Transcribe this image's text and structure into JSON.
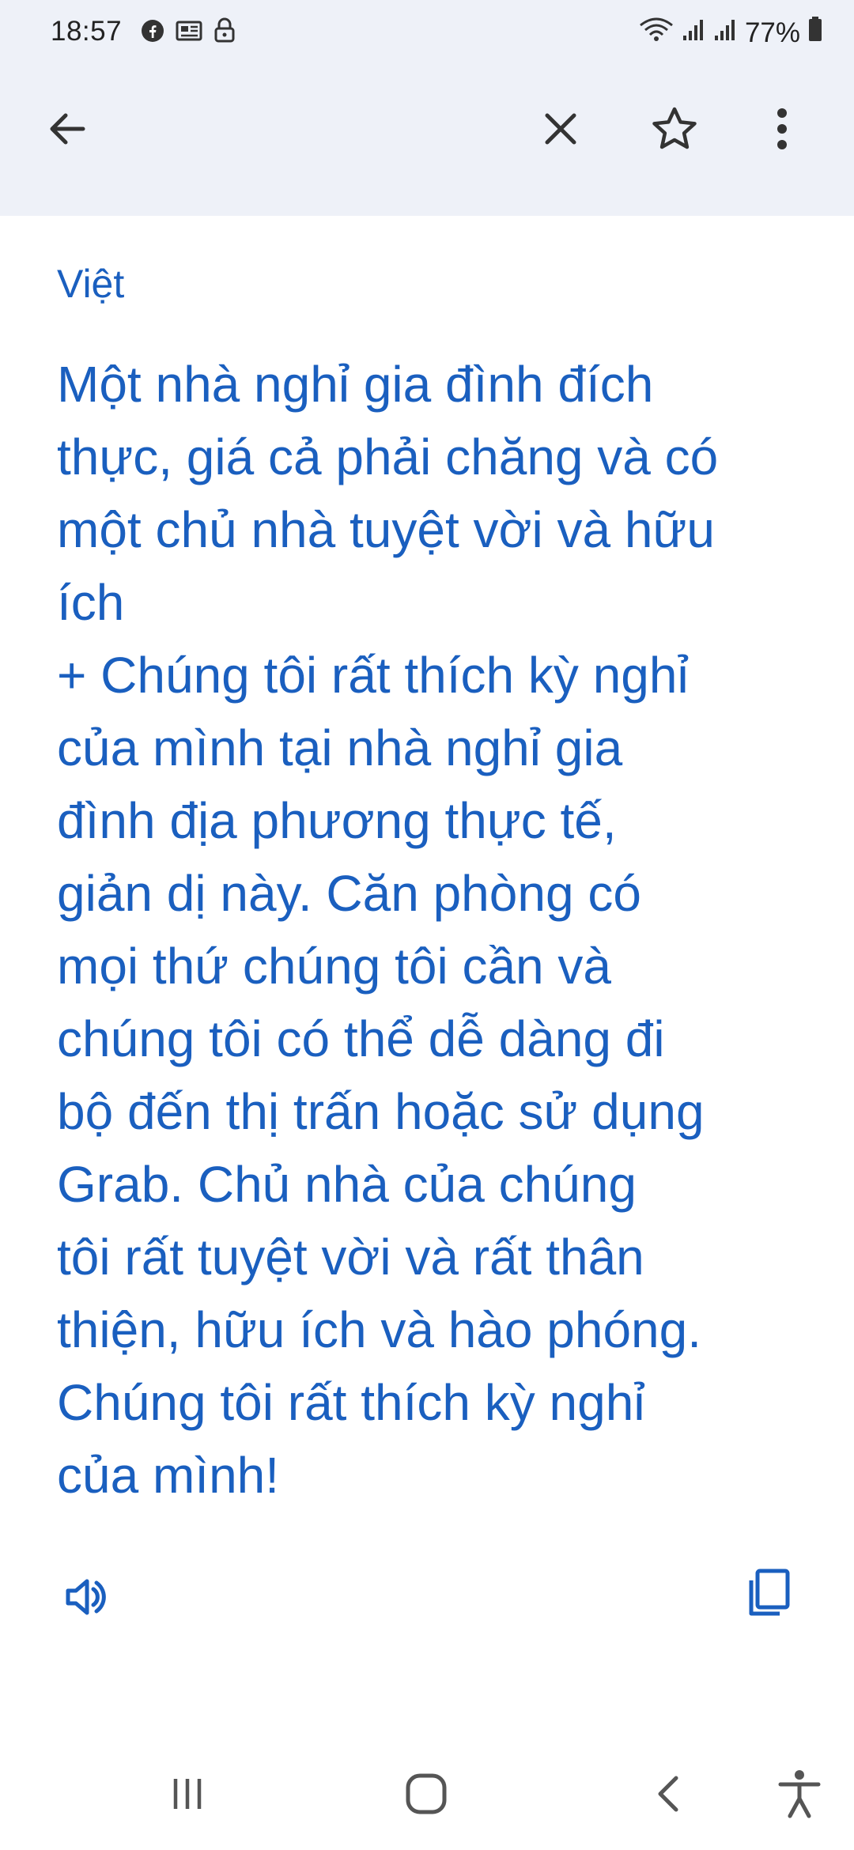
{
  "status_bar": {
    "time": "18:57",
    "battery": "77%",
    "left_icons": [
      "facebook-icon",
      "news-icon",
      "lock-icon"
    ],
    "right_icons": [
      "wifi-icon",
      "signal-icon",
      "signal-icon",
      "battery-icon"
    ]
  },
  "toolbar": {
    "icons": [
      "back-arrow-icon",
      "close-icon",
      "star-icon",
      "more-vert-icon"
    ]
  },
  "translation": {
    "language": "Việt",
    "text": "Một nhà nghỉ gia đình đích\nthực, giá cả phải chăng và có\nmột chủ nhà tuyệt vời và hữu\ních\n+ Chúng tôi rất thích kỳ nghỉ\ncủa mình tại nhà nghỉ gia\nđình địa phương thực tế,\ngiản dị này. Căn phòng có\nmọi thứ chúng tôi cần và\nchúng tôi có thể dễ dàng đi\nbộ đến thị trấn hoặc sử dụng\nGrab. Chủ nhà của chúng\ntôi rất tuyệt vời và rất thân\nthiện, hữu ích và hào phóng.\nChúng tôi rất thích kỳ nghỉ\ncủa mình!"
  },
  "actions": {
    "icons": [
      "speaker-icon",
      "copy-icon"
    ]
  },
  "nav_bar": {
    "icons": [
      "recents-icon",
      "home-icon",
      "nav-back-icon",
      "accessibility-icon"
    ]
  },
  "colors": {
    "accent": "#1a5fbf",
    "header_bg": "#eef1f8",
    "icon": "#333333"
  }
}
